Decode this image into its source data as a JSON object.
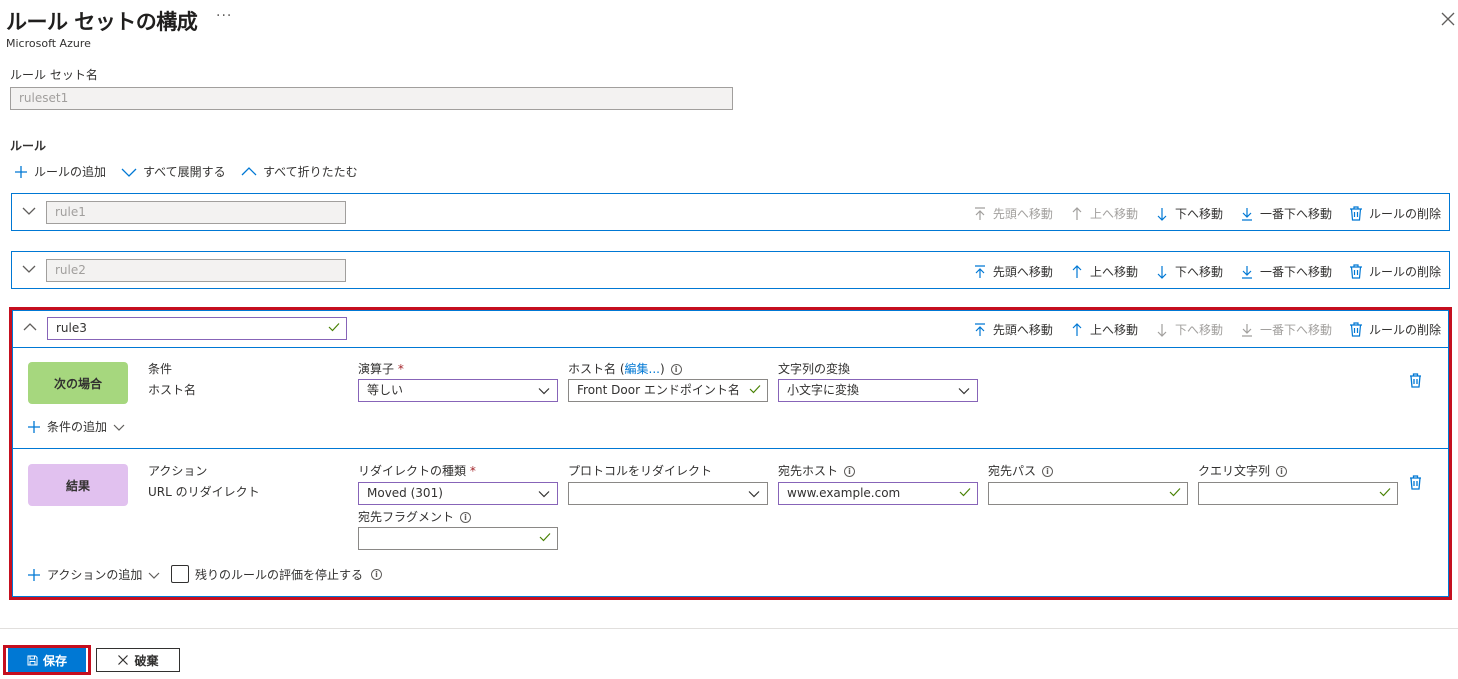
{
  "header": {
    "title": "ルール セットの構成",
    "more": "···",
    "subtitle": "Microsoft Azure"
  },
  "ruleset": {
    "label": "ルール セット名",
    "value": "ruleset1"
  },
  "rules_section": {
    "label": "ルール",
    "add_rule": "ルールの追加",
    "expand_all": "すべて展開する",
    "collapse_all": "すべて折りたたむ"
  },
  "rule_actions": {
    "move_top": "先頭へ移動",
    "move_up": "上へ移動",
    "move_down": "下へ移動",
    "move_bottom": "一番下へ移動",
    "delete": "ルールの削除"
  },
  "rules": [
    {
      "name": "rule1"
    },
    {
      "name": "rule2"
    },
    {
      "name": "rule3"
    }
  ],
  "condition": {
    "badge": "次の場合",
    "type_label": "条件",
    "type_value": "ホスト名",
    "operator_label": "演算子",
    "operator_value": "等しい",
    "hostname_label": "ホスト名 (",
    "hostname_edit": "編集...",
    "hostname_close": ")",
    "hostname_value": "Front Door エンドポイント名",
    "transform_label": "文字列の変換",
    "transform_value": "小文字に変換",
    "add_condition": "条件の追加"
  },
  "action": {
    "badge": "結果",
    "type_label": "アクション",
    "type_value": "URL のリダイレクト",
    "redirect_type_label": "リダイレクトの種類",
    "redirect_type_value": "Moved (301)",
    "protocol_label": "プロトコルをリダイレクト",
    "protocol_value": "",
    "dest_host_label": "宛先ホスト",
    "dest_host_value": "www.example.com",
    "dest_path_label": "宛先パス",
    "dest_path_value": "",
    "query_label": "クエリ文字列",
    "query_value": "",
    "fragment_label": "宛先フラグメント",
    "fragment_value": "",
    "add_action": "アクションの追加",
    "stop_eval": "残りのルールの評価を停止する"
  },
  "footer": {
    "save": "保存",
    "discard": "破棄"
  },
  "colors": {
    "accent": "#0078d4",
    "highlight": "#c50f1f",
    "condition_badge": "#a6d77e",
    "action_badge": "#e1c1ef",
    "check": "#498205",
    "focus": "#8764b8"
  }
}
